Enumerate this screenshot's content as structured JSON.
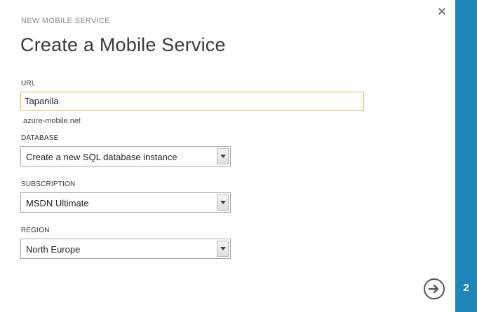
{
  "dialog": {
    "wizard_label": "NEW MOBILE SERVICE",
    "title": "Create a Mobile Service",
    "step": "2"
  },
  "form": {
    "url": {
      "label": "URL",
      "value": "Tapanila",
      "suffix": ".azure-mobile.net"
    },
    "database": {
      "label": "DATABASE",
      "selected": "Create a new SQL database instance"
    },
    "subscription": {
      "label": "SUBSCRIPTION",
      "selected": "MSDN Ultimate"
    },
    "region": {
      "label": "REGION",
      "selected": "North Europe"
    }
  },
  "icons": {
    "close": "close-icon",
    "next": "arrow-right-circle-icon"
  },
  "colors": {
    "accent": "#1e86b8",
    "focus_border": "#e6b84a"
  }
}
